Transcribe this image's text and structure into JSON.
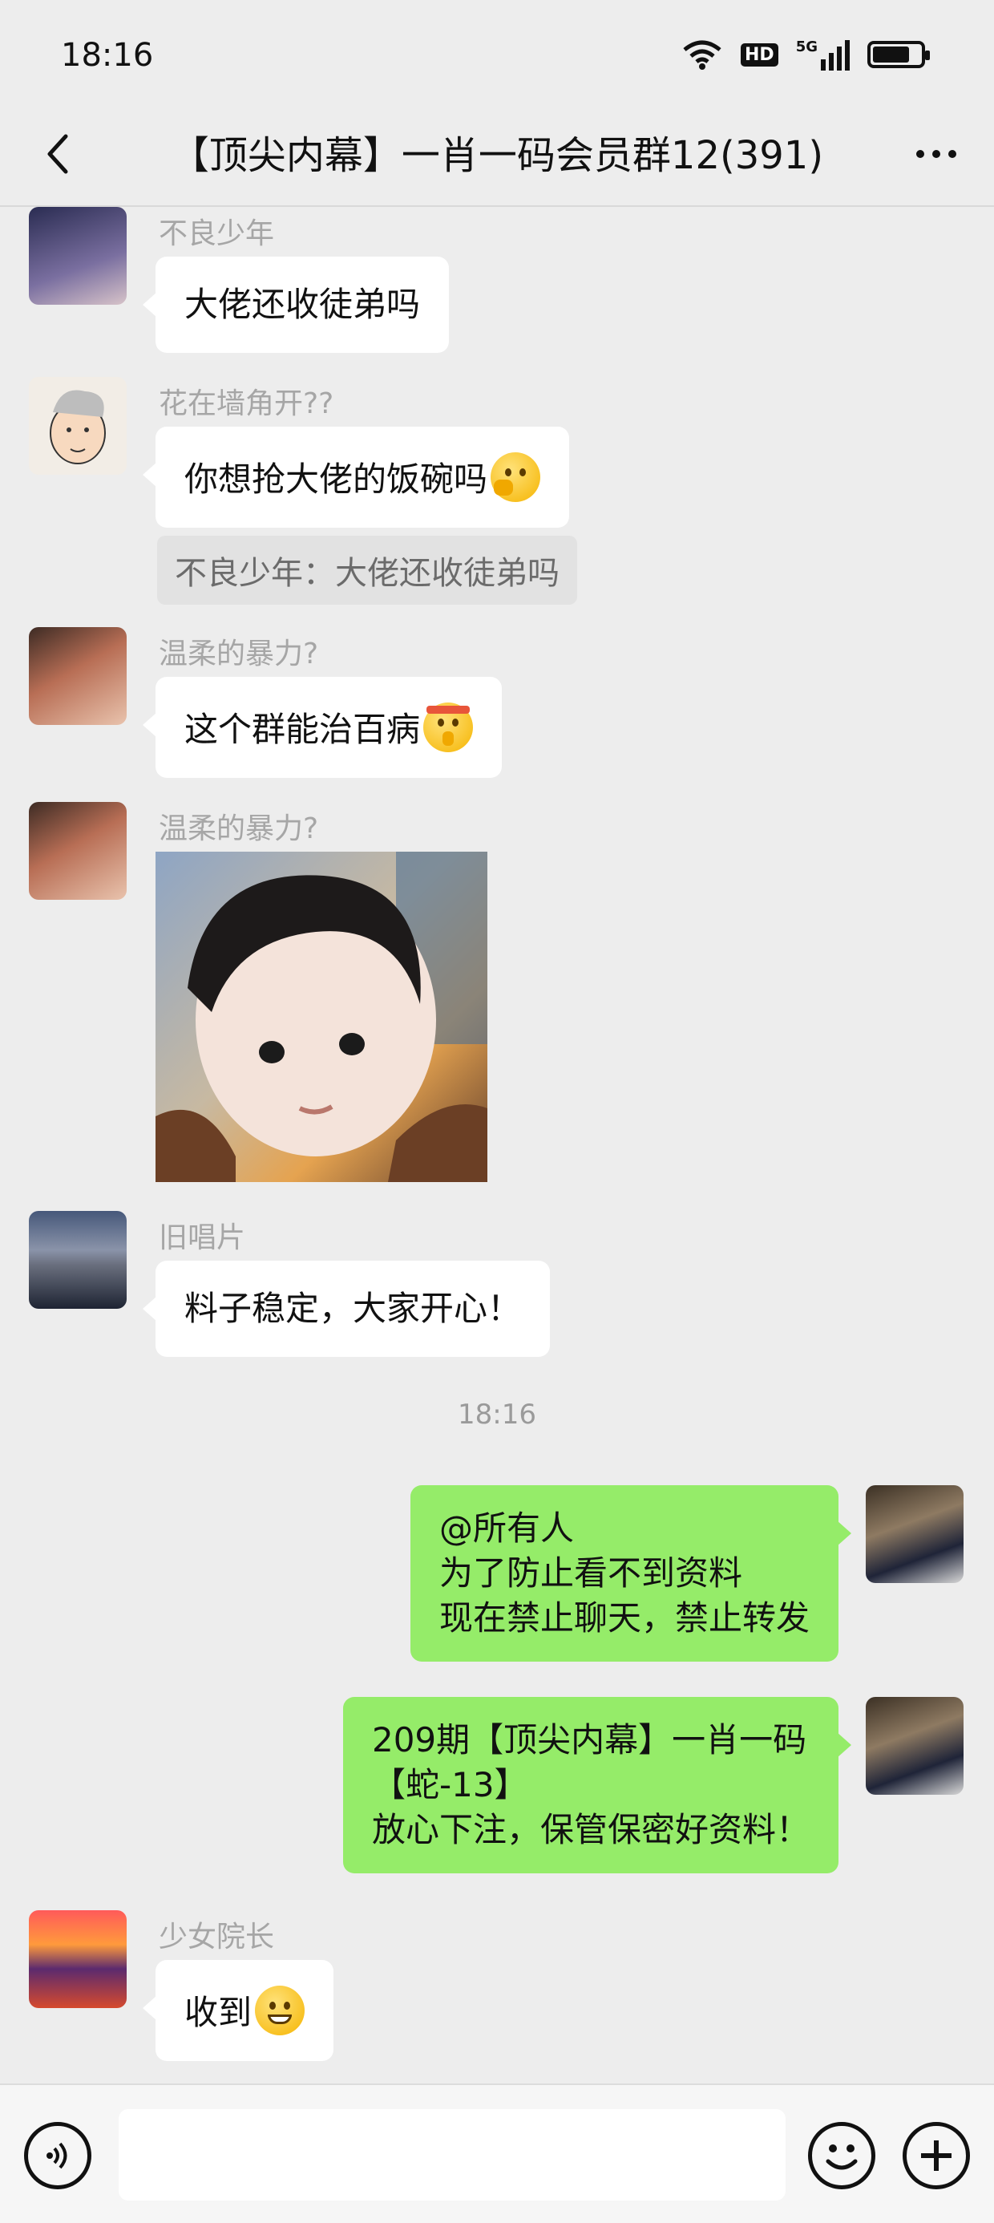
{
  "status_bar": {
    "time": "18:16",
    "icons": [
      "wifi-icon",
      "hd-icon",
      "5g-signal-icon",
      "battery-icon"
    ],
    "hd_label": "HD",
    "net_label": "5G"
  },
  "nav": {
    "title": "【顶尖内幕】一肖一码会员群12(391)",
    "back_icon": "back-chevron-icon",
    "more_icon": "more-dots-icon"
  },
  "messages": [
    {
      "sender": "不良少年",
      "text": "大佬还收徒弟吗",
      "side": "left",
      "avatar_color": "#3a3f6b"
    },
    {
      "sender": "花在墙角开??",
      "text": "你想抢大佬的饭碗吗",
      "emoji": "thinking-face-emoji",
      "quote": "不良少年：大佬还收徒弟吗",
      "side": "left",
      "avatar_color": "#f2ede6"
    },
    {
      "sender": "温柔的暴力?",
      "text": "这个群能治百病",
      "emoji": "shushing-face-emoji",
      "side": "left",
      "avatar_color": "#b86e55"
    },
    {
      "sender": "温柔的暴力?",
      "image": "child-photo",
      "side": "left",
      "avatar_color": "#b86e55"
    },
    {
      "sender": "旧唱片",
      "text": "料子稳定，大家开心！",
      "side": "left",
      "avatar_color": "#3c4f6e"
    },
    {
      "timestamp": "18:16"
    },
    {
      "lines": [
        "@所有人",
        "为了防止看不到资料",
        "现在禁止聊天，禁止转发"
      ],
      "side": "right",
      "avatar_color": "#5a4a3a"
    },
    {
      "lines": [
        "209期【顶尖内幕】一肖一码",
        "【蛇-13】",
        "放心下注，保管保密好资料！"
      ],
      "side": "right",
      "avatar_color": "#5a4a3a"
    },
    {
      "sender": "少女院长",
      "text": "收到",
      "emoji": "grinning-face-emoji",
      "side": "left",
      "avatar_color": "#d64a2e"
    }
  ],
  "input_bar": {
    "voice_icon": "voice-icon",
    "emoji_icon": "emoji-icon",
    "plus_icon": "plus-icon",
    "input_value": ""
  }
}
